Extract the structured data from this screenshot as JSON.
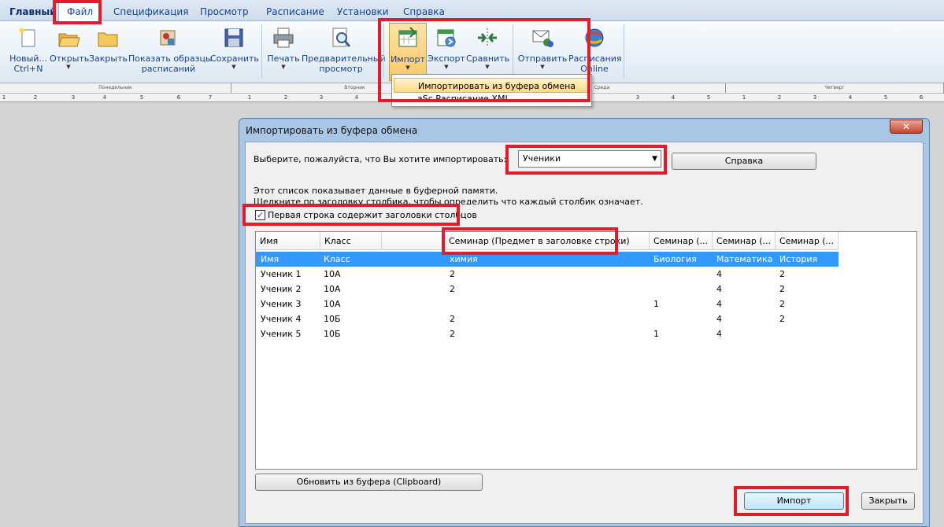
{
  "tabs": [
    "Главный",
    "Файл",
    "Спецификация",
    "Просмотр",
    "Расписание",
    "Установки",
    "Справка"
  ],
  "ribbon": {
    "new": {
      "label1": "Новый...",
      "label2": "Ctrl+N"
    },
    "open": {
      "label": "Открыть"
    },
    "close": {
      "label": "Закрыть"
    },
    "samples": {
      "label1": "Показать образцы",
      "label2": "расписаний"
    },
    "save": {
      "label": "Сохранить"
    },
    "print": {
      "label": "Печать"
    },
    "preview": {
      "label1": "Предварительный",
      "label2": "просмотр"
    },
    "import": {
      "label": "Импорт"
    },
    "export": {
      "label": "Экспорт"
    },
    "compare": {
      "label": "Сравнить"
    },
    "send": {
      "label": "Отправить"
    },
    "online": {
      "label1": "Расписания",
      "label2": "Online"
    }
  },
  "calendar": {
    "days": [
      "Понедельник",
      "Вторник",
      "Среда",
      "Четверг"
    ],
    "periods": [
      "1",
      "2",
      "3",
      "4",
      "5",
      "6",
      "7"
    ]
  },
  "dropdown": {
    "items": [
      "Импортировать из буфера обмена",
      "aSc Расписание XML"
    ]
  },
  "dialog": {
    "title": "Импортировать из буфера обмена",
    "close_glyph": "✕",
    "prompt": "Выберите, пожалуйста, что Вы хотите импортировать:",
    "type_value": "Ученики",
    "help_button": "Справка",
    "info_line1": "Этот список показывает данные в буферной памяти.",
    "info_line2": "Щелкните по заголовку столбика, чтобы определить что каждый столбик означает.",
    "first_row_checkbox": "Первая строка содержит заголовки столбцов",
    "checkbox_checked": true,
    "refresh_button": "Обновить из буфера (Clipboard)",
    "import_button": "Импорт",
    "close_button": "Закрыть"
  },
  "grid": {
    "columns": [
      "Имя",
      "Класс",
      "",
      "Семинар (Предмет в заголовке строки)",
      "Семинар (...",
      "Семинар (...",
      "Семинар (..."
    ],
    "rows": [
      [
        "Имя",
        "Класс",
        "",
        "химия",
        "Биология",
        "Математика",
        "История"
      ],
      [
        "Ученик 1",
        "10А",
        "",
        "2",
        "",
        "4",
        "2"
      ],
      [
        "Ученик 2",
        "10А",
        "",
        "2",
        "",
        "4",
        "2"
      ],
      [
        "Ученик 3",
        "10А",
        "",
        "",
        "1",
        "4",
        "2"
      ],
      [
        "Ученик 4",
        "10Б",
        "",
        "2",
        "",
        "4",
        "2"
      ],
      [
        "Ученик 5",
        "10Б",
        "",
        "2",
        "1",
        "4",
        ""
      ]
    ],
    "selected_row": 0
  },
  "colors": {
    "highlight": "#e21c2c",
    "selection": "#3399ff",
    "ribbon_text": "#15428b"
  }
}
